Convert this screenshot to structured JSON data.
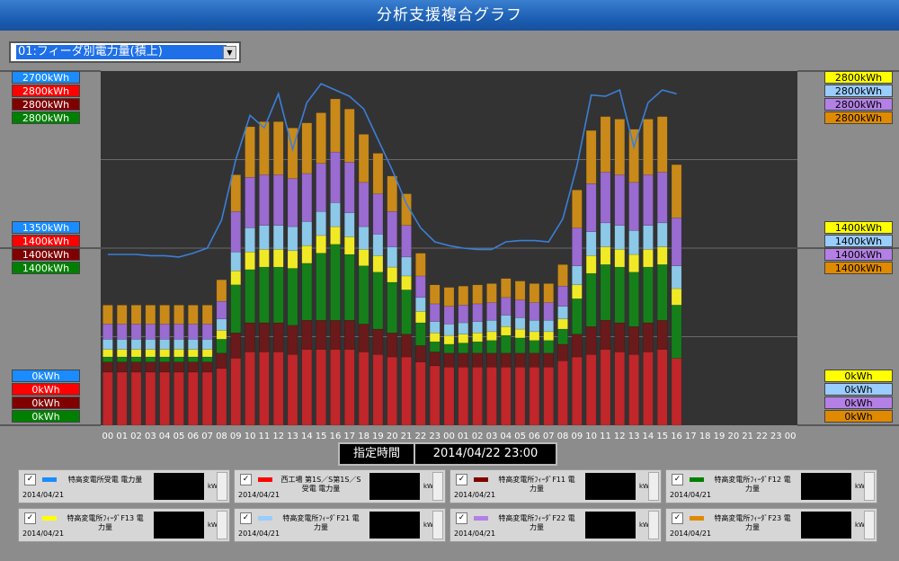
{
  "window": {
    "title": "分析支援複合グラフ"
  },
  "selector": {
    "value": "01:フィーダ別電力量(積上)"
  },
  "left_axis": {
    "top": [
      {
        "text": "2700kWh",
        "bg": "#1a8cff",
        "fg": "#ffffff"
      },
      {
        "text": "2800kWh",
        "bg": "#ff0000",
        "fg": "#ffffff"
      },
      {
        "text": "2800kWh",
        "bg": "#800000",
        "fg": "#ffffff"
      },
      {
        "text": "2800kWh",
        "bg": "#008000",
        "fg": "#ffffff"
      }
    ],
    "mid": [
      {
        "text": "1350kWh",
        "bg": "#1a8cff",
        "fg": "#ffffff"
      },
      {
        "text": "1400kWh",
        "bg": "#ff0000",
        "fg": "#ffffff"
      },
      {
        "text": "1400kWh",
        "bg": "#800000",
        "fg": "#ffffff"
      },
      {
        "text": "1400kWh",
        "bg": "#008000",
        "fg": "#ffffff"
      }
    ],
    "bottom": [
      {
        "text": "0kWh",
        "bg": "#1a8cff",
        "fg": "#ffffff"
      },
      {
        "text": "0kWh",
        "bg": "#ff0000",
        "fg": "#ffffff"
      },
      {
        "text": "0kWh",
        "bg": "#800000",
        "fg": "#ffffff"
      },
      {
        "text": "0kWh",
        "bg": "#008000",
        "fg": "#ffffff"
      }
    ]
  },
  "right_axis": {
    "top": [
      {
        "text": "2800kWh",
        "bg": "#ffff00",
        "fg": "#000000"
      },
      {
        "text": "2800kWh",
        "bg": "#99ccff",
        "fg": "#000000"
      },
      {
        "text": "2800kWh",
        "bg": "#b380e6",
        "fg": "#000000"
      },
      {
        "text": "2800kWh",
        "bg": "#e08a00",
        "fg": "#000000"
      }
    ],
    "mid": [
      {
        "text": "1400kWh",
        "bg": "#ffff00",
        "fg": "#000000"
      },
      {
        "text": "1400kWh",
        "bg": "#99ccff",
        "fg": "#000000"
      },
      {
        "text": "1400kWh",
        "bg": "#b380e6",
        "fg": "#000000"
      },
      {
        "text": "1400kWh",
        "bg": "#e08a00",
        "fg": "#000000"
      }
    ],
    "bottom": [
      {
        "text": "0kWh",
        "bg": "#ffff00",
        "fg": "#000000"
      },
      {
        "text": "0kWh",
        "bg": "#99ccff",
        "fg": "#000000"
      },
      {
        "text": "0kWh",
        "bg": "#b380e6",
        "fg": "#000000"
      },
      {
        "text": "0kWh",
        "bg": "#e08a00",
        "fg": "#000000"
      }
    ]
  },
  "time_display": {
    "label": "指定時間",
    "value": "2014/04/22 23:00"
  },
  "panels": [
    {
      "date": "2014/04/21",
      "name": "特高変電所受電 電力量",
      "color": "#1a8cff",
      "unit": "kWh"
    },
    {
      "date": "2014/04/21",
      "name": "西工場 第1S／S第1S／S受電 電力量",
      "color": "#ff0000",
      "unit": "kWh"
    },
    {
      "date": "2014/04/21",
      "name": "特高変電所ﾌｨｰﾀﾞF11 電力量",
      "color": "#800000",
      "unit": "kWh"
    },
    {
      "date": "2014/04/21",
      "name": "特高変電所ﾌｨｰﾀﾞF12 電力量",
      "color": "#008000",
      "unit": "kWh"
    },
    {
      "date": "2014/04/21",
      "name": "特高変電所ﾌｨｰﾀﾞF13 電力量",
      "color": "#ffff00",
      "unit": "kWh"
    },
    {
      "date": "2014/04/21",
      "name": "特高変電所ﾌｨｰﾀﾞF21 電力量",
      "color": "#99ccff",
      "unit": "kWh"
    },
    {
      "date": "2014/04/21",
      "name": "特高変電所ﾌｨｰﾀﾞF22 電力量",
      "color": "#b380e6",
      "unit": "kWh"
    },
    {
      "date": "2014/04/21",
      "name": "特高変電所ﾌｨｰﾀﾞF23 電力量",
      "color": "#e08a00",
      "unit": "kWh"
    }
  ],
  "chart_data": {
    "type": "bar",
    "stacked": true,
    "x": [
      "00",
      "01",
      "02",
      "03",
      "04",
      "05",
      "06",
      "07",
      "08",
      "09",
      "10",
      "11",
      "12",
      "13",
      "14",
      "15",
      "16",
      "17",
      "18",
      "19",
      "20",
      "21",
      "22",
      "23",
      "00",
      "01",
      "02",
      "03",
      "04",
      "05",
      "06",
      "07",
      "08",
      "09",
      "10",
      "11",
      "12",
      "13",
      "14",
      "15",
      "16",
      "17",
      "18",
      "19",
      "20",
      "21",
      "22",
      "23",
      "00"
    ],
    "ylim": [
      0,
      2800
    ],
    "series": [
      {
        "color": "#c0262a",
        "values": [
          420,
          420,
          420,
          420,
          420,
          420,
          420,
          420,
          450,
          530,
          580,
          580,
          580,
          560,
          600,
          600,
          600,
          600,
          580,
          560,
          540,
          540,
          500,
          470,
          460,
          460,
          460,
          460,
          460,
          460,
          460,
          460,
          510,
          540,
          560,
          600,
          580,
          560,
          580,
          600,
          530,
          0,
          0,
          0,
          0,
          0,
          0,
          0,
          0
        ]
      },
      {
        "color": "#6a1a1a",
        "values": [
          80,
          80,
          80,
          80,
          80,
          80,
          80,
          80,
          120,
          200,
          230,
          230,
          230,
          230,
          230,
          230,
          230,
          230,
          220,
          200,
          190,
          180,
          130,
          110,
          110,
          110,
          110,
          110,
          110,
          110,
          110,
          110,
          130,
          180,
          220,
          230,
          230,
          220,
          230,
          230,
          0,
          0,
          0,
          0,
          0,
          0,
          0,
          0,
          0
        ]
      },
      {
        "color": "#15801a",
        "values": [
          40,
          40,
          40,
          40,
          40,
          40,
          40,
          40,
          110,
          380,
          420,
          440,
          440,
          450,
          450,
          530,
          600,
          520,
          460,
          450,
          400,
          350,
          180,
          80,
          70,
          80,
          90,
          100,
          140,
          120,
          100,
          100,
          120,
          280,
          420,
          440,
          440,
          430,
          440,
          440,
          420,
          0,
          0,
          0,
          0,
          0,
          0,
          0,
          0
        ]
      },
      {
        "color": "#f0ea26",
        "values": [
          60,
          60,
          60,
          60,
          60,
          60,
          60,
          60,
          70,
          110,
          140,
          140,
          140,
          140,
          140,
          140,
          140,
          140,
          130,
          130,
          120,
          110,
          90,
          70,
          70,
          70,
          70,
          70,
          70,
          70,
          70,
          70,
          80,
          110,
          140,
          140,
          140,
          140,
          140,
          140,
          130,
          0,
          0,
          0,
          0,
          0,
          0,
          0,
          0
        ]
      },
      {
        "color": "#8cc8e8",
        "values": [
          80,
          80,
          80,
          80,
          80,
          80,
          80,
          80,
          90,
          150,
          190,
          190,
          190,
          190,
          190,
          190,
          190,
          190,
          180,
          170,
          160,
          150,
          110,
          90,
          90,
          90,
          90,
          90,
          90,
          90,
          90,
          90,
          100,
          150,
          190,
          190,
          190,
          190,
          190,
          190,
          180,
          0,
          0,
          0,
          0,
          0,
          0,
          0,
          0
        ]
      },
      {
        "color": "#9a6bd0",
        "values": [
          120,
          120,
          120,
          120,
          120,
          120,
          120,
          120,
          140,
          320,
          400,
          400,
          400,
          380,
          380,
          380,
          400,
          400,
          350,
          320,
          280,
          250,
          170,
          140,
          140,
          140,
          140,
          140,
          140,
          140,
          140,
          140,
          160,
          300,
          380,
          400,
          400,
          380,
          400,
          400,
          380,
          0,
          0,
          0,
          0,
          0,
          0,
          0,
          0
        ]
      },
      {
        "color": "#c98a1a",
        "values": [
          150,
          150,
          150,
          150,
          150,
          150,
          150,
          150,
          170,
          290,
          400,
          420,
          420,
          400,
          400,
          400,
          420,
          420,
          380,
          320,
          280,
          250,
          180,
          150,
          150,
          150,
          150,
          150,
          150,
          150,
          150,
          150,
          170,
          300,
          420,
          440,
          440,
          420,
          440,
          440,
          420,
          0,
          0,
          0,
          0,
          0,
          0,
          0,
          0
        ]
      }
    ],
    "line": {
      "color": "#3b7fd8",
      "values": [
        1350,
        1350,
        1350,
        1340,
        1340,
        1330,
        1360,
        1400,
        1620,
        2100,
        2450,
        2350,
        2620,
        2180,
        2550,
        2700,
        2650,
        2600,
        2500,
        2260,
        2020,
        1750,
        1560,
        1450,
        1420,
        1400,
        1390,
        1390,
        1450,
        1460,
        1460,
        1450,
        1630,
        2050,
        2610,
        2600,
        2650,
        2200,
        2550,
        2650,
        2620,
        null,
        null,
        null,
        null,
        null,
        null,
        null,
        null
      ]
    },
    "grid": true
  }
}
